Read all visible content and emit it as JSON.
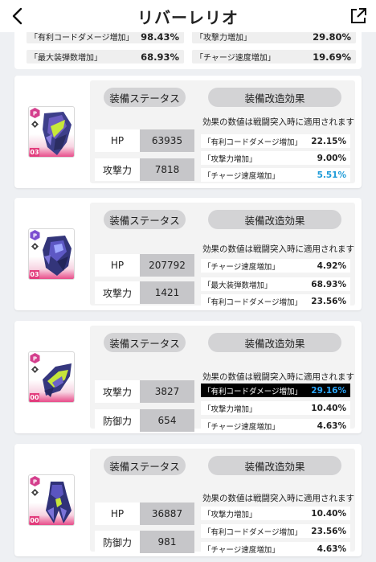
{
  "header": {
    "title": "リバーレリオ"
  },
  "summary": [
    {
      "label": "「有利コードダメージ増加」",
      "value": "98.43%"
    },
    {
      "label": "「攻撃力増加」",
      "value": "29.80%"
    },
    {
      "label": "「最大装弾数増加」",
      "value": "68.93%"
    },
    {
      "label": "「チャージ速度増加」",
      "value": "19.69%"
    }
  ],
  "cards": [
    {
      "level": "03",
      "status_label": "装備ステータス",
      "mod_label": "装備改造効果",
      "note": "効果の数値は戦闘突入時に適用されます",
      "stats": [
        {
          "label": "HP",
          "value": "63935"
        },
        {
          "label": "攻撃力",
          "value": "7818"
        }
      ],
      "effects": [
        {
          "label": "「有利コードダメージ増加」",
          "value": "22.15%"
        },
        {
          "label": "「攻撃力増加」",
          "value": "9.00%"
        },
        {
          "label": "「チャージ速度増加」",
          "value": "5.51%"
        }
      ]
    },
    {
      "level": "03",
      "status_label": "装備ステータス",
      "mod_label": "装備改造効果",
      "note": "効果の数値は戦闘突入時に適用されます",
      "stats": [
        {
          "label": "HP",
          "value": "207792"
        },
        {
          "label": "攻撃力",
          "value": "1421"
        }
      ],
      "effects": [
        {
          "label": "「チャージ速度増加」",
          "value": "4.92%"
        },
        {
          "label": "「最大装弾数増加」",
          "value": "68.93%"
        },
        {
          "label": "「有利コードダメージ増加」",
          "value": "23.56%"
        }
      ]
    },
    {
      "level": "00",
      "status_label": "装備ステータス",
      "mod_label": "装備改造効果",
      "note": "効果の数値は戦闘突入時に適用されます",
      "stats": [
        {
          "label": "攻撃力",
          "value": "3827"
        },
        {
          "label": "防御力",
          "value": "654"
        }
      ],
      "effects": [
        {
          "label": "「有利コードダメージ増加」",
          "value": "29.16%"
        },
        {
          "label": "「攻撃力増加」",
          "value": "10.40%"
        },
        {
          "label": "「チャージ速度増加」",
          "value": "4.63%"
        }
      ]
    },
    {
      "level": "00",
      "status_label": "装備ステータス",
      "mod_label": "装備改造効果",
      "note": "効果の数値は戦闘突入時に適用されます",
      "stats": [
        {
          "label": "HP",
          "value": "36887"
        },
        {
          "label": "防御力",
          "value": "981"
        }
      ],
      "effects": [
        {
          "label": "「攻撃力増加」",
          "value": "10.40%"
        },
        {
          "label": "「有利コードダメージ増加」",
          "value": "23.56%"
        },
        {
          "label": "「チャージ速度増加」",
          "value": "4.63%"
        }
      ]
    }
  ],
  "colors": {
    "accent_pink": "#e23c7c",
    "value_blue": "#1e9bd8",
    "highlight_blue": "#2aa8ff"
  },
  "icons": [
    "back-arrow-icon",
    "share-icon",
    "rarity-badge-icon",
    "burst-mark-icon"
  ]
}
